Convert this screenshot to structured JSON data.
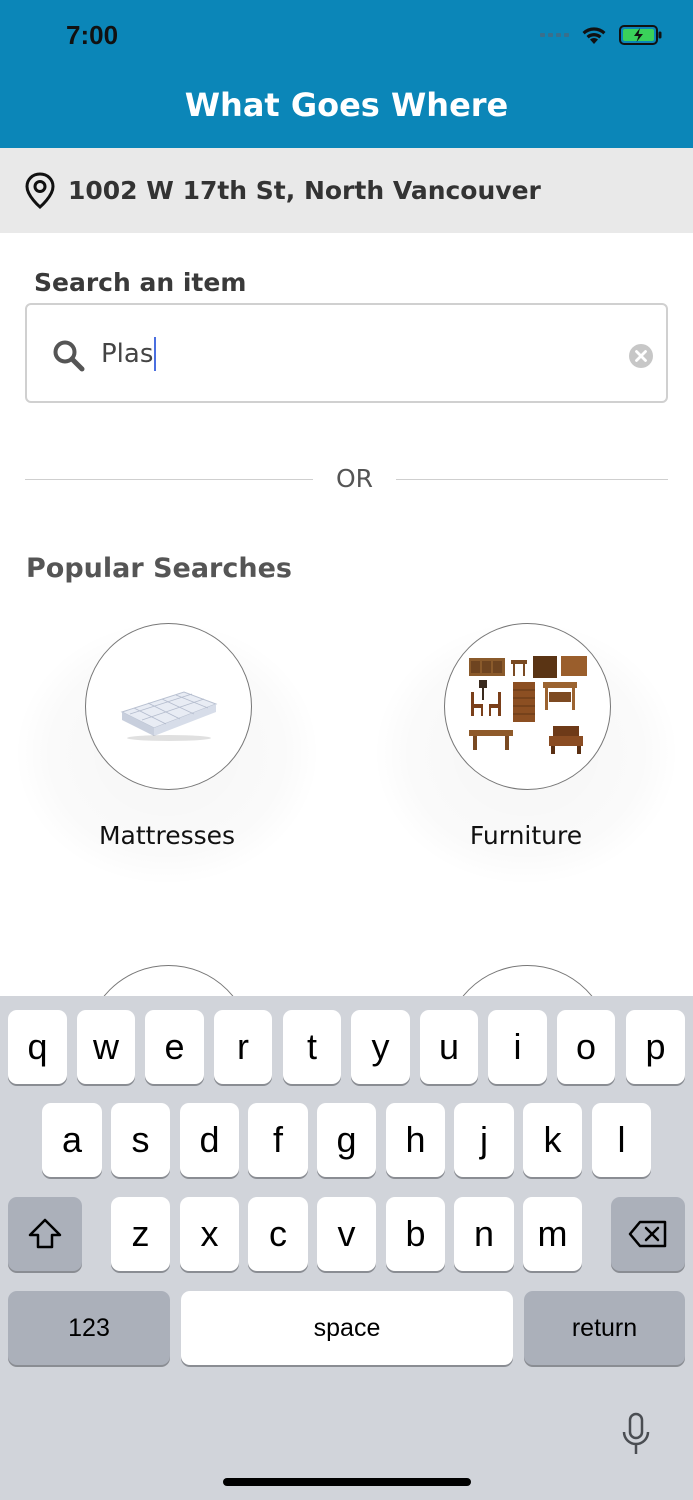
{
  "status": {
    "time": "7:00"
  },
  "header": {
    "title": "What Goes Where"
  },
  "location": {
    "address": "1002 W 17th St, North Vancouver"
  },
  "search": {
    "label": "Search an item",
    "value": "Plas"
  },
  "divider": {
    "or": "OR"
  },
  "popular": {
    "title": "Popular Searches",
    "items": [
      {
        "label": "Mattresses"
      },
      {
        "label": "Furniture"
      }
    ]
  },
  "keyboard": {
    "row1": [
      "q",
      "w",
      "e",
      "r",
      "t",
      "y",
      "u",
      "i",
      "o",
      "p"
    ],
    "row2": [
      "a",
      "s",
      "d",
      "f",
      "g",
      "h",
      "j",
      "k",
      "l"
    ],
    "row3": [
      "z",
      "x",
      "c",
      "v",
      "b",
      "n",
      "m"
    ],
    "numbers_label": "123",
    "space_label": "space",
    "return_label": "return"
  },
  "colors": {
    "header": "#0b86b8",
    "location_bar": "#e9e9e9",
    "keyboard": "#d1d4da"
  }
}
